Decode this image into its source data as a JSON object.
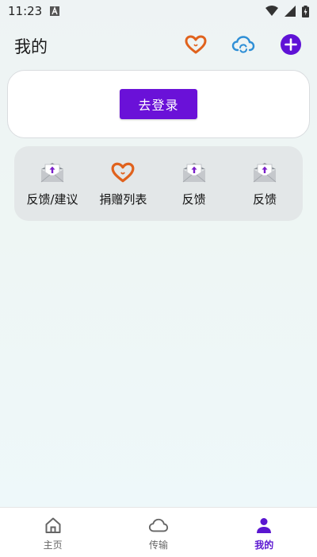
{
  "status_bar": {
    "time": "11:23",
    "icons": [
      "a-notification-icon",
      "wifi-icon",
      "signal-icon",
      "battery-charging-icon"
    ]
  },
  "header": {
    "title": "我的",
    "actions": [
      "donate-heart-icon",
      "cloud-sync-icon",
      "add-icon"
    ]
  },
  "login": {
    "button_label": "去登录"
  },
  "grid": {
    "items": [
      {
        "label": "反馈/建议",
        "icon": "feedback-mail-icon"
      },
      {
        "label": "捐赠列表",
        "icon": "donate-heart-icon"
      },
      {
        "label": "反馈",
        "icon": "feedback-mail-icon"
      },
      {
        "label": "反馈",
        "icon": "feedback-mail-icon"
      }
    ]
  },
  "bottom_nav": {
    "items": [
      {
        "label": "主页",
        "icon": "home-icon"
      },
      {
        "label": "传输",
        "icon": "cloud-icon"
      },
      {
        "label": "我的",
        "icon": "person-icon",
        "active": true
      }
    ]
  },
  "colors": {
    "accent": "#6a11d8",
    "heart": "#e0621d",
    "cloud": "#2f8fd6",
    "nav_active": "#5a16d0"
  }
}
